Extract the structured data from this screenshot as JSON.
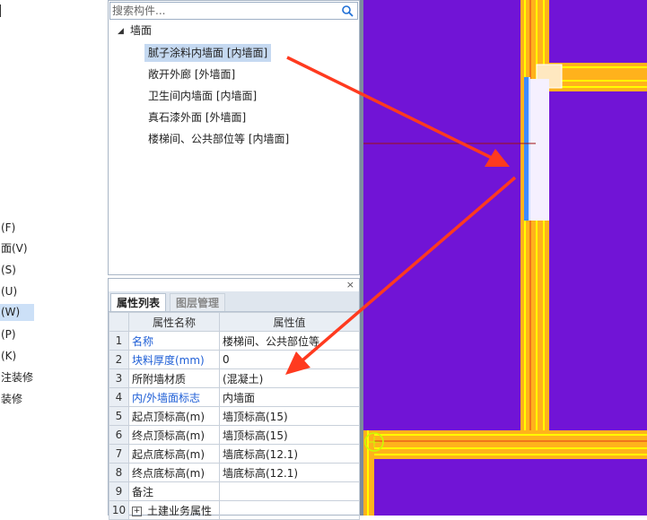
{
  "left_menu": [
    "(F)",
    "面(V)",
    "(S)",
    "(U)",
    "(W)",
    "(P)",
    "(K)",
    "注装修",
    "装修"
  ],
  "left_menu_selected_index": 4,
  "search": {
    "placeholder": "搜索构件..."
  },
  "tree": {
    "root_label": "墙面",
    "children": [
      "腻子涂料内墙面 [内墙面]",
      "敞开外廊 [外墙面]",
      "卫生间内墙面 [内墙面]",
      "真石漆外面 [外墙面]",
      "楼梯间、公共部位等 [内墙面]"
    ],
    "selected_index": 0
  },
  "properties_panel": {
    "close_label": "×",
    "tabs": [
      "属性列表",
      "图层管理"
    ],
    "active_tab": 0,
    "headers": {
      "name": "属性名称",
      "value": "属性值"
    },
    "rows": [
      {
        "idx": "1",
        "name": "名称",
        "value": "楼梯间、公共部位等",
        "highlight": true
      },
      {
        "idx": "2",
        "name": "块料厚度(mm)",
        "value": "0",
        "highlight": true
      },
      {
        "idx": "3",
        "name": "所附墙材质",
        "value": "(混凝土)",
        "highlight": false
      },
      {
        "idx": "4",
        "name": "内/外墙面标志",
        "value": "内墙面",
        "highlight": true
      },
      {
        "idx": "5",
        "name": "起点顶标高(m)",
        "value": "墙顶标高(15)",
        "highlight": false
      },
      {
        "idx": "6",
        "name": "终点顶标高(m)",
        "value": "墙顶标高(15)",
        "highlight": false
      },
      {
        "idx": "7",
        "name": "起点底标高(m)",
        "value": "墙底标高(12.1)",
        "highlight": false
      },
      {
        "idx": "8",
        "name": "终点底标高(m)",
        "value": "墙底标高(12.1)",
        "highlight": false
      },
      {
        "idx": "9",
        "name": "备注",
        "value": "",
        "highlight": false
      },
      {
        "idx": "10",
        "name": "土建业务属性",
        "value": "",
        "highlight": false,
        "expandable": true,
        "expand_symbol": "+"
      }
    ]
  },
  "colors": {
    "canvas_background": "#7114d6",
    "wall_band": "#ffb21c",
    "wall_line": "#ffff00",
    "selection_blue": "#3d8bff",
    "arrow_red": "#ff3a1f",
    "label_blue": "#1f5fd6"
  },
  "icons": {
    "search": "magnifier-icon",
    "close": "close-icon",
    "expand": "plus-icon",
    "tree_toggle": "triangle-down-icon"
  }
}
